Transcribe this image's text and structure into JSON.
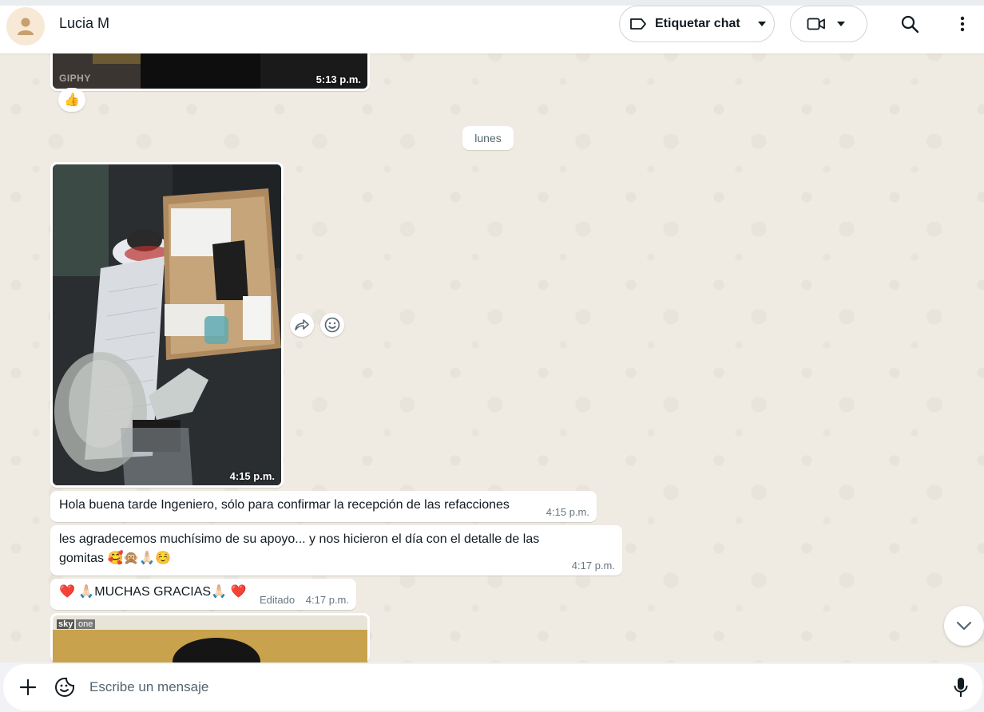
{
  "colors": {
    "bubble_in": "#ffffff",
    "wallpaper": "#efeae2",
    "text_primary": "#111b21",
    "text_secondary": "#667781",
    "reaction_heart": "#e0245e"
  },
  "header": {
    "contact_name": "Lucia M",
    "avatar_icon": "person-icon",
    "label_button": "Etiquetar chat",
    "label_icon": "tag-icon",
    "video_icon": "video-camera-icon",
    "search_icon": "search-icon",
    "menu_icon": "kebab-menu-icon"
  },
  "messages": {
    "gif": {
      "watermark": "GIPHY",
      "time": "5:13 p.m.",
      "reaction": "👍"
    },
    "date_divider": "lunes",
    "photo": {
      "time": "4:15 p.m.",
      "forward_icon": "forward-icon",
      "react_icon": "emoji-icon"
    },
    "text1": {
      "text": "Hola buena tarde Ingeniero, sólo para confirmar la recepción de las refacciones",
      "time": "4:15 p.m."
    },
    "text2": {
      "line1": "les agradecemos muchísimo de su apoyo... y nos hicieron el día con el detalle de las",
      "line2": "gomitas 🥰🙊🙏🏻☺️",
      "time": "4:17 p.m."
    },
    "text3": {
      "text": "❤️ 🙏🏻MUCHAS GRACIAS🙏🏻 ❤️",
      "edited": "Editado",
      "time": "4:17 p.m."
    },
    "video": {
      "watermark_sky": "sky",
      "watermark_one": "one"
    }
  },
  "composer": {
    "placeholder": "Escribe un mensaje",
    "attach_icon": "plus-icon",
    "sticker_icon": "sticker-icon",
    "mic_icon": "microphone-icon"
  },
  "scroll_icon": "chevron-down-icon"
}
